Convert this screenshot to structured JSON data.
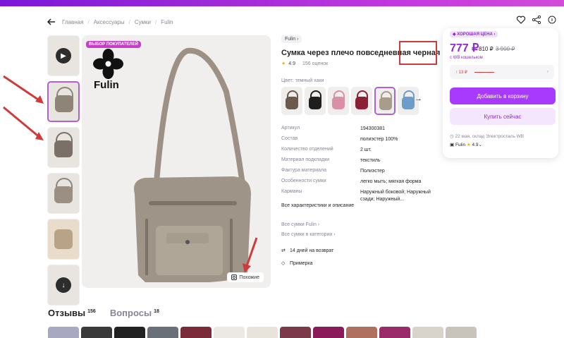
{
  "breadcrumbs": [
    "Главная",
    "Аксессуары",
    "Сумки",
    "Fulin"
  ],
  "product": {
    "brand": "Fulin",
    "title": "Сумка через плечо повседневная черная",
    "rating": "4.9",
    "reviews_count": "156 оценок",
    "color_label": "Цвет: темный хаки",
    "choice_badge": "ВЫБОР ПОКУПАТЕЛЕЙ",
    "logo_text": "Fulin",
    "similar_label": "Похожие"
  },
  "specs": [
    {
      "k": "Артикул",
      "v": "194300381"
    },
    {
      "k": "Состав",
      "v": "полиэстер 100%"
    },
    {
      "k": "Количество отделений",
      "v": "2 шт."
    },
    {
      "k": "Материал подкладки",
      "v": "текстиль"
    },
    {
      "k": "Фактура материала",
      "v": "Полиэстер"
    },
    {
      "k": "Особенности сумки",
      "v": "легко мыть; мягкая форма"
    },
    {
      "k": "Карманы",
      "v": "Наружный боковой; Наружный сзади; Наружный..."
    }
  ],
  "links": {
    "all_specs": "Все характеристики и описание",
    "all_brand": "Все сумки Fulin",
    "all_category": "Все сумки в категории"
  },
  "perks": {
    "return": "14 дней на возврат",
    "fitting": "Примерка"
  },
  "buy": {
    "badge": "ХОРОШАЯ ЦЕНА",
    "price": "777 ₽",
    "price_no_wallet": "810 ₽",
    "old_price": "3 900 ₽",
    "wallet_note": "с WB кошельком",
    "price_change": "↑ 13 ₽",
    "cart_button": "Добавить в корзину",
    "buy_now_button": "Купить сейчас",
    "delivery": "22 мая, склад Электросталь WB",
    "seller": "Fulin",
    "seller_rating": "4.9"
  },
  "tabs": [
    {
      "label": "Отзывы",
      "count": "156"
    },
    {
      "label": "Вопросы",
      "count": "18"
    }
  ],
  "colors": {
    "accent": "#a73afd",
    "brand_purple": "#8e2bcb",
    "highlight_red": "#d13a3a"
  },
  "swatch_colors": [
    "#6b5a4e",
    "#1e1e1e",
    "#d98fa8",
    "#8b2035",
    "#a89c8c",
    "#6d9cc9"
  ]
}
